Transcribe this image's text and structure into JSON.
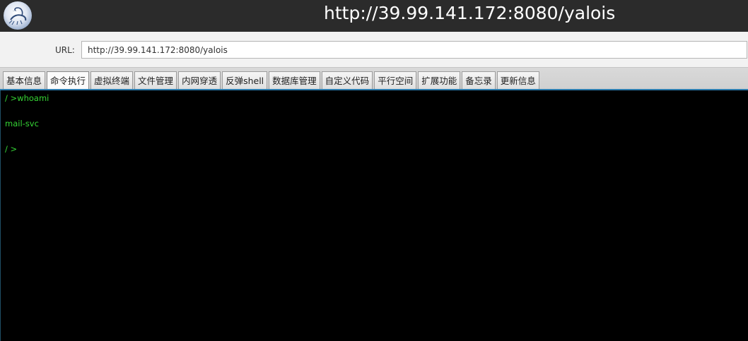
{
  "window": {
    "title": "http://39.99.141.172:8080/yalois",
    "logo_icon": "scorpion-logo-icon"
  },
  "url_bar": {
    "label": "URL:",
    "value": "http://39.99.141.172:8080/yalois"
  },
  "tabs": [
    {
      "label": "基本信息",
      "active": false
    },
    {
      "label": "命令执行",
      "active": true
    },
    {
      "label": "虚拟终端",
      "active": false
    },
    {
      "label": "文件管理",
      "active": false
    },
    {
      "label": "内网穿透",
      "active": false
    },
    {
      "label": "反弹shell",
      "active": false
    },
    {
      "label": "数据库管理",
      "active": false
    },
    {
      "label": "自定义代码",
      "active": false
    },
    {
      "label": "平行空间",
      "active": false
    },
    {
      "label": "扩展功能",
      "active": false
    },
    {
      "label": "备忘录",
      "active": false
    },
    {
      "label": "更新信息",
      "active": false
    }
  ],
  "console": {
    "lines": [
      "/ >whoami",
      "mail-svc",
      "/ >"
    ],
    "text_color": "#35d635",
    "background": "#000000"
  },
  "colors": {
    "titlebar": "#2b2b2b",
    "accent": "#2c7db0"
  }
}
